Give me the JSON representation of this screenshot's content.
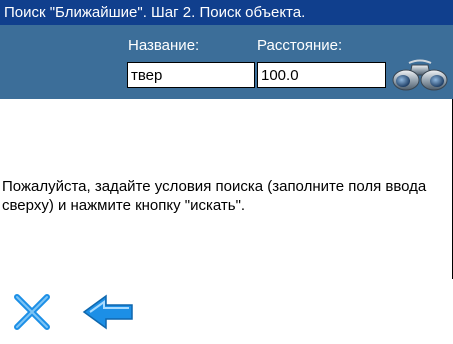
{
  "window": {
    "title": "Поиск \"Ближайшие\". Шаг 2. Поиск объекта."
  },
  "form": {
    "name_label": "Название:",
    "name_value": "твер",
    "distance_label": "Расстояние:",
    "distance_value": "100.0"
  },
  "search_button": {
    "icon": "binoculars-icon"
  },
  "message": "Пожалуйста, задайте условия поиска (заполните поля ввода сверху) и нажмите кнопку \"искать\".",
  "toolbar": {
    "close_icon": "close-icon",
    "back_icon": "back-arrow-icon"
  },
  "colors": {
    "title_bar": "#103f8d",
    "header": "#3c6e99",
    "icon_blue": "#1c8fe6"
  }
}
